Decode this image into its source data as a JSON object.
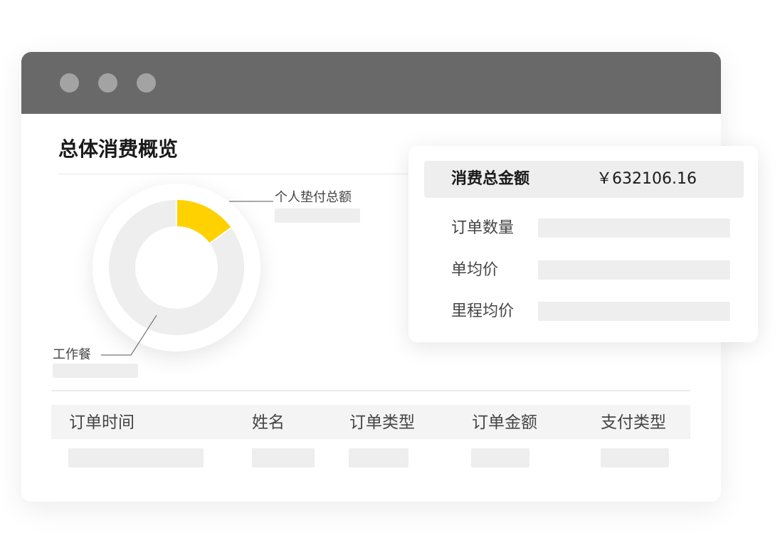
{
  "window": {
    "controls": [
      "close",
      "minimize",
      "maximize"
    ]
  },
  "page": {
    "title": "总体消费概览"
  },
  "donut": {
    "segments": [
      {
        "label": "个人垫付总额",
        "fraction": 0.15,
        "color": "#FFD100"
      },
      {
        "label": "工作餐",
        "fraction": 0.85,
        "color": "#EEEEEE"
      }
    ]
  },
  "summary": {
    "total_label": "消费总金额",
    "total_value": "￥632106.16",
    "rows": [
      {
        "label": "订单数量"
      },
      {
        "label": "单均价"
      },
      {
        "label": "里程均价"
      }
    ]
  },
  "table": {
    "columns": [
      "订单时间",
      "姓名",
      "订单类型",
      "订单金额",
      "支付类型"
    ]
  }
}
